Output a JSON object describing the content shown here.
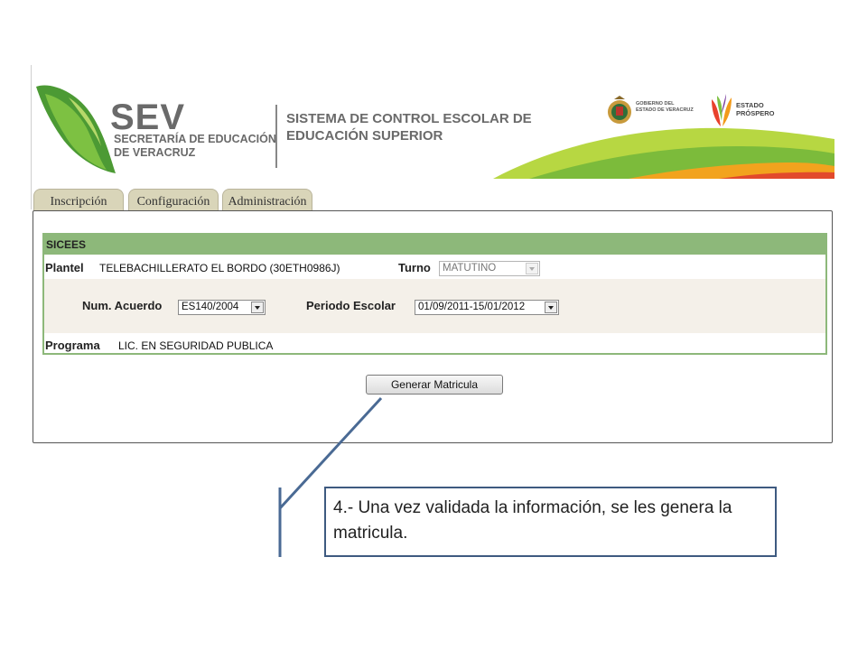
{
  "header": {
    "sev": "SEV",
    "sev_line1": "SECRETARÍA DE EDUCACIÓN",
    "sev_line2": "DE VERACRUZ",
    "system_line1": "SISTEMA DE CONTROL ESCOLAR DE",
    "system_line2": "EDUCACIÓN SUPERIOR",
    "gob_line1": "GOBIERNO DEL",
    "gob_line2": "ESTADO DE VERACRUZ",
    "prospero_line1": "ESTADO",
    "prospero_line2": "PRÓSPERO"
  },
  "tabs": [
    "Inscripción",
    "Configuración",
    "Administración"
  ],
  "form": {
    "section_title": "SICEES",
    "plantel_label": "Plantel",
    "plantel_value": "TELEBACHILLERATO EL BORDO (30ETH0986J)",
    "turno_label": "Turno",
    "turno_value": "MATUTINO",
    "acuerdo_label": "Num. Acuerdo",
    "acuerdo_value": "ES140/2004",
    "periodo_label": "Periodo Escolar",
    "periodo_value": "01/09/2011-15/01/2012",
    "programa_label": "Programa",
    "programa_value": "LIC. EN SEGURIDAD PUBLICA"
  },
  "button": {
    "generate_label": "Generar Matricula"
  },
  "callout": {
    "text": "4.- Una vez validada la información, se les genera la matricula."
  },
  "colors": {
    "section_green": "#8db87a",
    "callout_border": "#3e5a80",
    "tab_bg": "#d9d5b9"
  }
}
